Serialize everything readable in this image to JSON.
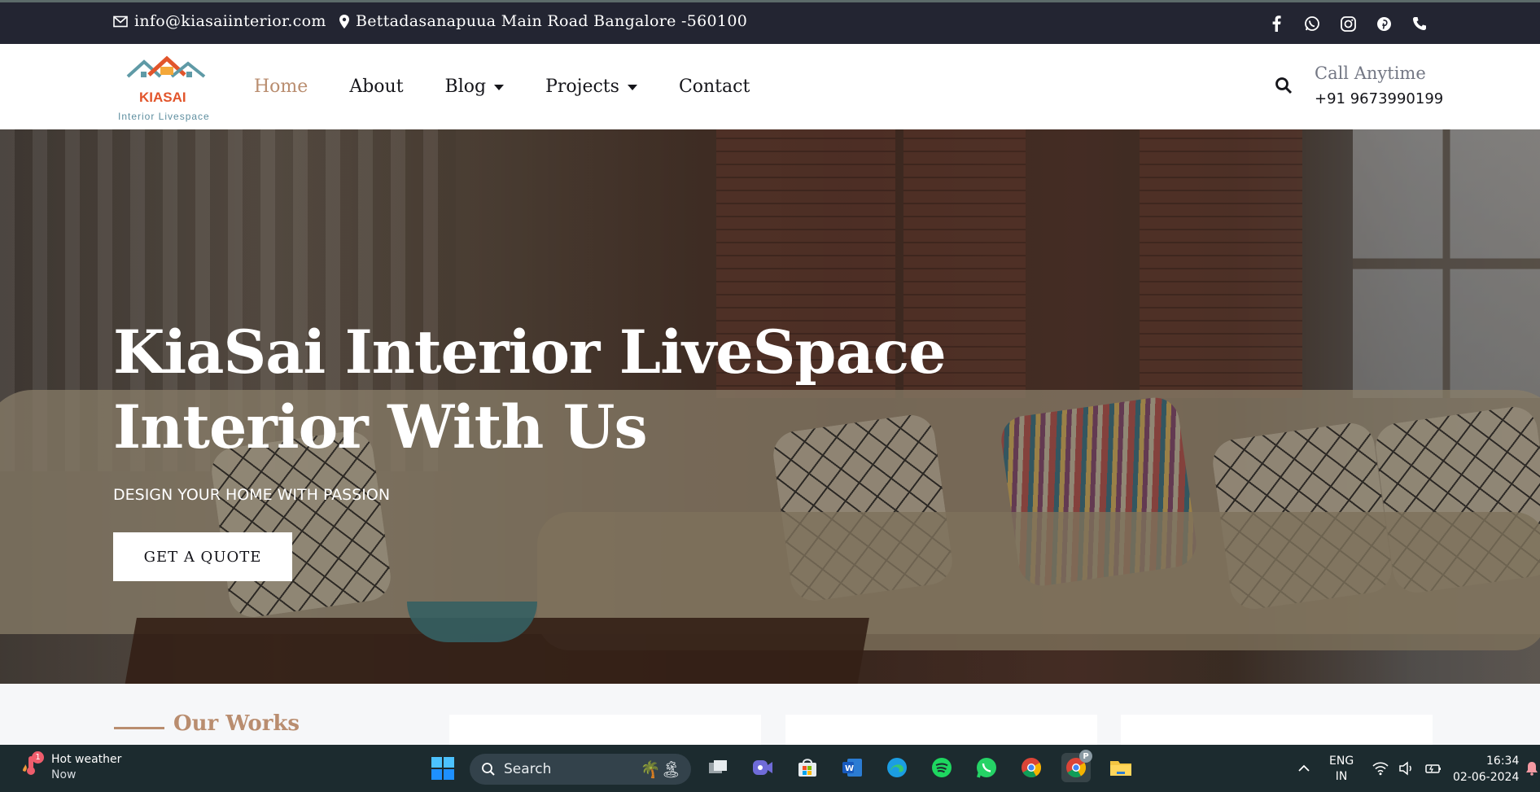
{
  "topbar": {
    "email": "info@kiasaiinterior.com",
    "address": "Bettadasanapuua Main Road Bangalore -560100",
    "socials": [
      "facebook-icon",
      "whatsapp-icon",
      "instagram-icon",
      "pinterest-icon",
      "phone-icon"
    ]
  },
  "nav": {
    "logo_brand": "KIASAI",
    "logo_sub": "Interior Livespace",
    "items": [
      {
        "label": "Home",
        "active": true,
        "dropdown": false
      },
      {
        "label": "About",
        "active": false,
        "dropdown": false
      },
      {
        "label": "Blog",
        "active": false,
        "dropdown": true
      },
      {
        "label": "Projects",
        "active": false,
        "dropdown": true
      },
      {
        "label": "Contact",
        "active": false,
        "dropdown": false
      }
    ],
    "call_label": "Call Anytime",
    "call_number": "+91 9673990199"
  },
  "hero": {
    "title_line1": "KiaSai Interior LiveSpace",
    "title_line2": "Interior With Us",
    "tagline": "DESIGN YOUR HOME WITH PASSION",
    "cta": "GET A QUOTE"
  },
  "works": {
    "title": "Our Works"
  },
  "taskbar": {
    "weather_title": "Hot weather",
    "weather_sub": "Now",
    "weather_badge": "1",
    "search_placeholder": "Search",
    "lang_top": "ENG",
    "lang_bottom": "IN",
    "time": "16:34",
    "date": "02-06-2024",
    "chrome_badge": "P"
  },
  "colors": {
    "accent": "#b98d6f",
    "topbar_bg": "#232532",
    "logo_red": "#e2552b",
    "taskbar_bg": "#1c2b2f"
  }
}
